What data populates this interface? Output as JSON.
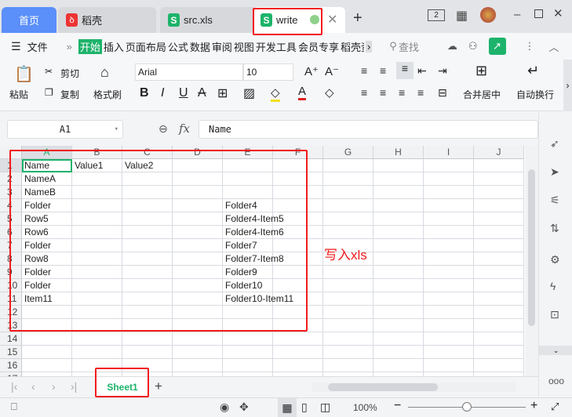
{
  "tabs": [
    {
      "label": "首页"
    },
    {
      "label": "稻壳",
      "icon": "docer-icon"
    },
    {
      "label": "src.xls",
      "icon": "spreadsheet-icon"
    },
    {
      "label": "write",
      "icon": "spreadsheet-icon",
      "active": true
    }
  ],
  "titlebar": {
    "window_badge": "2"
  },
  "menu": {
    "file": "文件",
    "items": [
      "开始",
      "插入",
      "页面布局",
      "公式",
      "数据",
      "审阅",
      "视图",
      "开发工具",
      "会员专享",
      "稻壳资"
    ],
    "active": "开始",
    "search": "查找"
  },
  "ribbon": {
    "paste": "粘贴",
    "cut": "剪切",
    "copy": "复制",
    "format_painter": "格式刷",
    "font": "Arial",
    "size": "10",
    "merge": "合并居中",
    "wrap": "自动换行"
  },
  "formula_bar": {
    "cell_ref": "A1",
    "fx": "fx",
    "value": "Name"
  },
  "columns": [
    "A",
    "B",
    "C",
    "D",
    "E",
    "F",
    "G",
    "H",
    "I",
    "J"
  ],
  "rows": [
    [
      "Name",
      "Value1",
      "Value2",
      "",
      "",
      ""
    ],
    [
      "NameA",
      "",
      "",
      "",
      "",
      ""
    ],
    [
      "NameB",
      "",
      "",
      "",
      "",
      ""
    ],
    [
      "Folder",
      "",
      "",
      "",
      "Folder4",
      ""
    ],
    [
      "Row5",
      "",
      "",
      "",
      "Folder4-Item5",
      ""
    ],
    [
      "Row6",
      "",
      "",
      "",
      "Folder4-Item6",
      ""
    ],
    [
      "Folder",
      "",
      "",
      "",
      "Folder7",
      ""
    ],
    [
      "Row8",
      "",
      "",
      "",
      "Folder7-Item8",
      ""
    ],
    [
      "Folder",
      "",
      "",
      "",
      "Folder9",
      ""
    ],
    [
      "Folder",
      "",
      "",
      "",
      "Folder10",
      ""
    ],
    [
      "Item11",
      "",
      "",
      "",
      "Folder10-Item11",
      ""
    ],
    [],
    [],
    [],
    [],
    [],
    []
  ],
  "annotation": "写入xls",
  "sheets": [
    {
      "label": "Sheet1",
      "active": true
    }
  ],
  "status": {
    "zoom": "100%",
    "zoom_level": 0.5
  },
  "colors": {
    "accent": "#1db36b",
    "annotation": "#f21b1b",
    "home_tab": "#5b8ff9"
  }
}
